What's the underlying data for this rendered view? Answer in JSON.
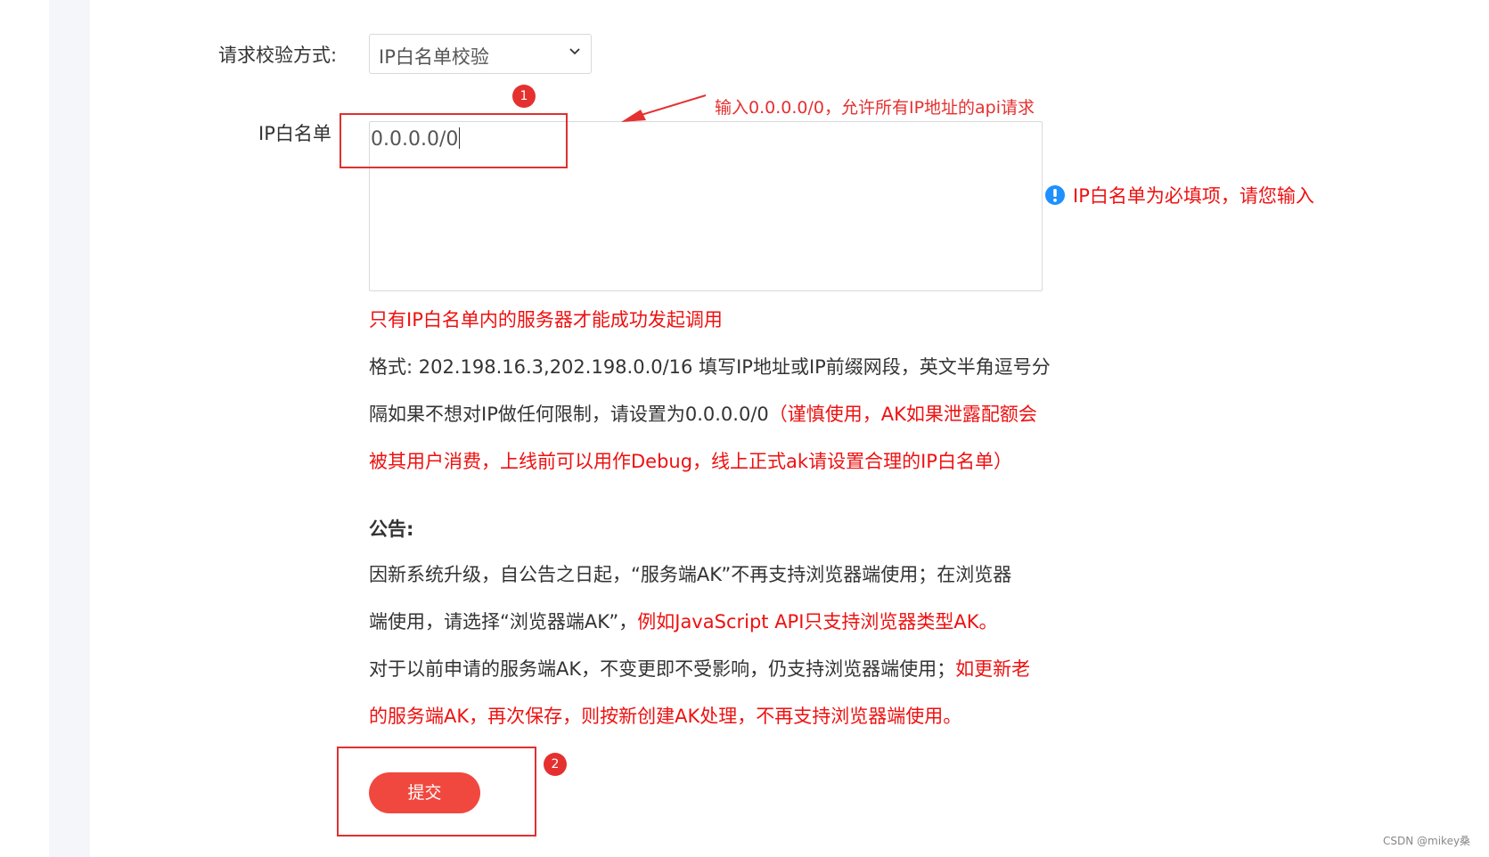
{
  "form": {
    "method_label": "请求校验方式:",
    "method_selected": "IP白名单校验",
    "ip_label": "IP白名单",
    "ip_value": "0.0.0.0/0",
    "validation_message": "IP白名单为必填项，请您输入"
  },
  "annotations": {
    "arrow_note": "输入0.0.0.0/0，允许所有IP地址的api请求",
    "badge1": "1",
    "badge2": "2"
  },
  "help": {
    "line1": "只有IP白名单内的服务器才能成功发起调用",
    "line2": "格式: 202.198.16.3,202.198.0.0/16 填写IP地址或IP前缀网段，英文半角逗号分",
    "line3_a": "隔如果不想对IP做任何限制，请设置为0.0.0.0/0",
    "line3_b": "（谨慎使用，AK如果泄露配额会",
    "line4": "被其用户消费，上线前可以用作Debug，线上正式ak请设置合理的IP白名单）"
  },
  "notice": {
    "title": "公告:",
    "line1": "因新系统升级，自公告之日起，“服务端AK”不再支持浏览器端使用；在浏览器",
    "line2_a": "端使用，请选择“浏览器端AK”，",
    "line2_b": "例如JavaScript API只支持浏览器类型AK。",
    "line3_a": "对于以前申请的服务端AK，不变更即不受影响，仍支持浏览器端使用；",
    "line3_b": "如更新老",
    "line4": "的服务端AK，再次保存，则按新创建AK处理，不再支持浏览器端使用。"
  },
  "submit_label": "提交",
  "watermark": "CSDN @mikey桑",
  "colors": {
    "accent_red": "#ee1111",
    "button": "#f0483e",
    "info_icon": "#1e90ff"
  }
}
